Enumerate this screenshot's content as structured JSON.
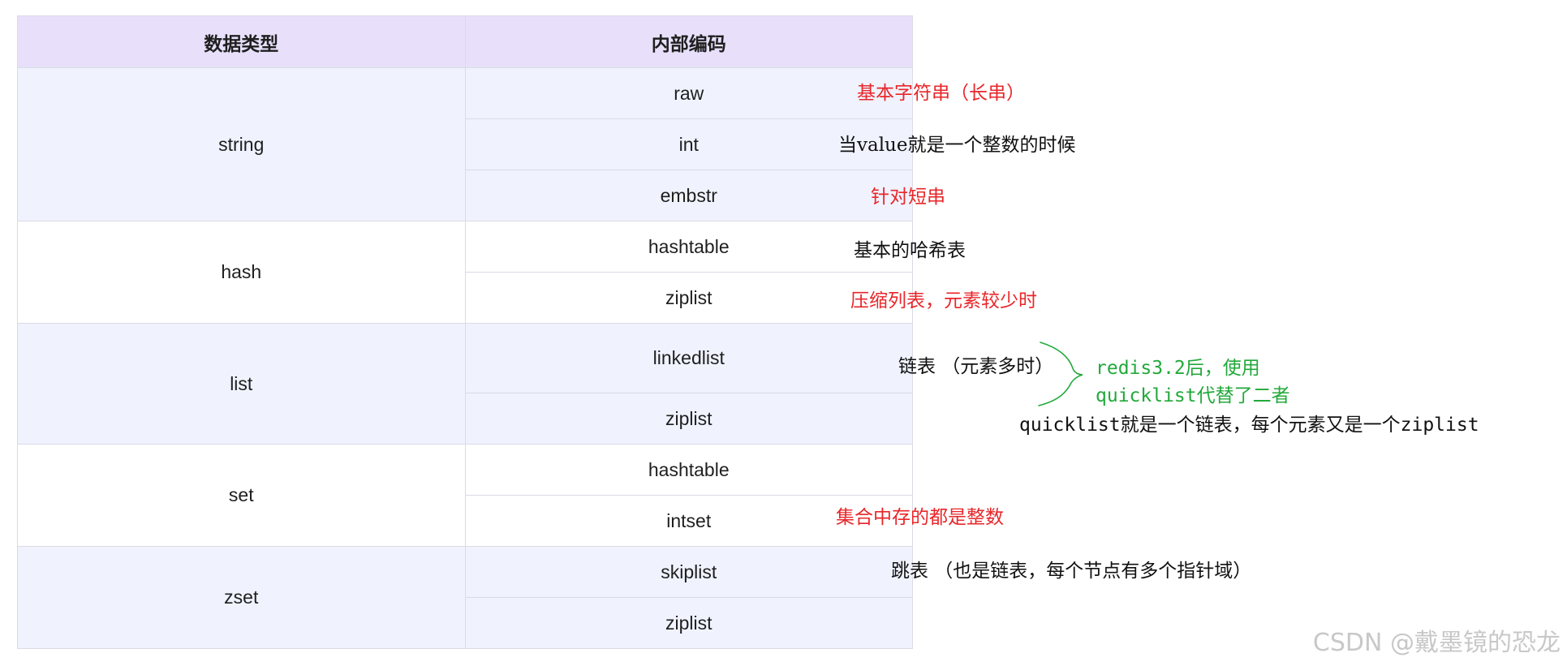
{
  "table": {
    "headers": [
      "数据类型",
      "内部编码"
    ],
    "groups": [
      {
        "type": "string",
        "encodings": [
          "raw",
          "int",
          "embstr"
        ]
      },
      {
        "type": "hash",
        "encodings": [
          "hashtable",
          "ziplist"
        ]
      },
      {
        "type": "list",
        "encodings": [
          "linkedlist",
          "ziplist"
        ]
      },
      {
        "type": "set",
        "encodings": [
          "hashtable",
          "intset"
        ]
      },
      {
        "type": "zset",
        "encodings": [
          "skiplist",
          "ziplist"
        ]
      }
    ]
  },
  "annotations": {
    "raw": "基本字符串（长串）",
    "int": "当value就是一个整数的时候",
    "embstr": "针对短串",
    "hashtable": "基本的哈希表",
    "hash_ziplist": "压缩列表，元素较少时",
    "linkedlist": "链表 （元素多时）",
    "quicklist_line1": "redis3.2后，使用",
    "quicklist_line2": "quicklist代替了二者",
    "quicklist_desc": "quicklist就是一个链表，每个元素又是一个ziplist",
    "intset": "集合中存的都是整数",
    "skiplist": "跳表 （也是链表，每个节点有多个指针域）"
  },
  "colors": {
    "header_bg": "#e8e0fb",
    "shaded_row_bg": "#f0f3fe",
    "annotation_red": "#e8262a",
    "annotation_green": "#22a93a"
  },
  "watermark": "CSDN @戴墨镜的恐龙"
}
